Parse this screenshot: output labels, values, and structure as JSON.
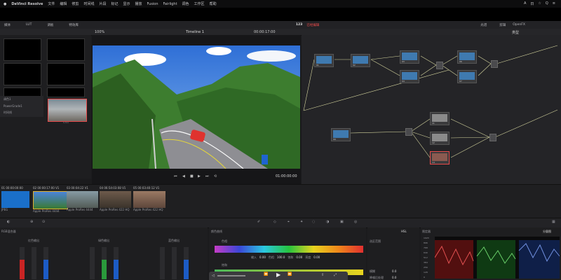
{
  "menubar": {
    "app": "DaVinci Resolve",
    "items": [
      "文件",
      "编辑",
      "修剪",
      "时间线",
      "片段",
      "标记",
      "显示",
      "播放",
      "Fusion",
      "Fairlight",
      "调色",
      "工作区",
      "帮助"
    ],
    "right": [
      "A",
      "日",
      "☆",
      "Q",
      "≡"
    ]
  },
  "toolbar": {
    "left_items": [
      "媒体",
      "LUT",
      "调板",
      "特效库"
    ],
    "project": "123",
    "project_status": "已经编辑",
    "right_items": [
      "光谱",
      "剪辑",
      "OpenFX"
    ],
    "right_label": "类型"
  },
  "viewer": {
    "zoom": "100%",
    "timeline_name": "Timeline 1",
    "timecode": "00:00:17:00",
    "timecode_bottom": "01:00:00:00"
  },
  "mediapool": {
    "items": [
      "调色1",
      "PowerGrade1",
      "时间线"
    ],
    "clip_label": "1-3-1"
  },
  "nodes": {
    "labels": [
      "01",
      "02",
      "03",
      "04",
      "05",
      "06",
      "07",
      "08",
      "09",
      "10",
      "11",
      "12",
      "13",
      "14"
    ]
  },
  "timeline": {
    "clips": [
      {
        "num": "01",
        "tc": "00:00:00:00",
        "v": "V1",
        "codec": "JPEG"
      },
      {
        "num": "02",
        "tc": "00:00:17:00",
        "v": "V1",
        "codec": "Apple ProRes 4444"
      },
      {
        "num": "03",
        "tc": "00:04:22",
        "v": "V1",
        "codec": "Apple ProRes 4444"
      },
      {
        "num": "04",
        "tc": "06:54:03:08",
        "v": "V1",
        "codec": "Apple ProRes 422 HQ"
      },
      {
        "num": "05",
        "tc": "00:03:40:12",
        "v": "V1",
        "codec": "Apple ProRes 422 HQ"
      }
    ]
  },
  "bottom": {
    "rgb_mixer": "RGB混合器",
    "red_out": "红色输出",
    "green_out": "绿色输出",
    "blue_out": "蓝色输出",
    "hue_curve": "颜色曲线",
    "row1": "色相",
    "row2": "饱和",
    "fields": {
      "in_label": "输入",
      "in_val": "0.00",
      "hue_label": "色相",
      "hue_val": "100.0",
      "sat_label": "饱和",
      "sat_val": "0.00",
      "lum_label": "亮度",
      "lum_val": "0.00"
    },
    "hsl": "HSL",
    "qualifier_tab": "限定器",
    "selection": "选区范围",
    "blur": "模糊",
    "blur_val": "0.0",
    "noise": "降噪后处理",
    "noise_val": "0.0",
    "scopes": "示波器",
    "scope_type": "分量图",
    "scale": [
      "1023",
      "896",
      "768",
      "640",
      "512",
      "384",
      "256",
      "128",
      "0"
    ]
  },
  "colors": {
    "accent": "#e94a4a",
    "selected_clip": "#e0b030",
    "node_link": "#d8d8a0"
  }
}
